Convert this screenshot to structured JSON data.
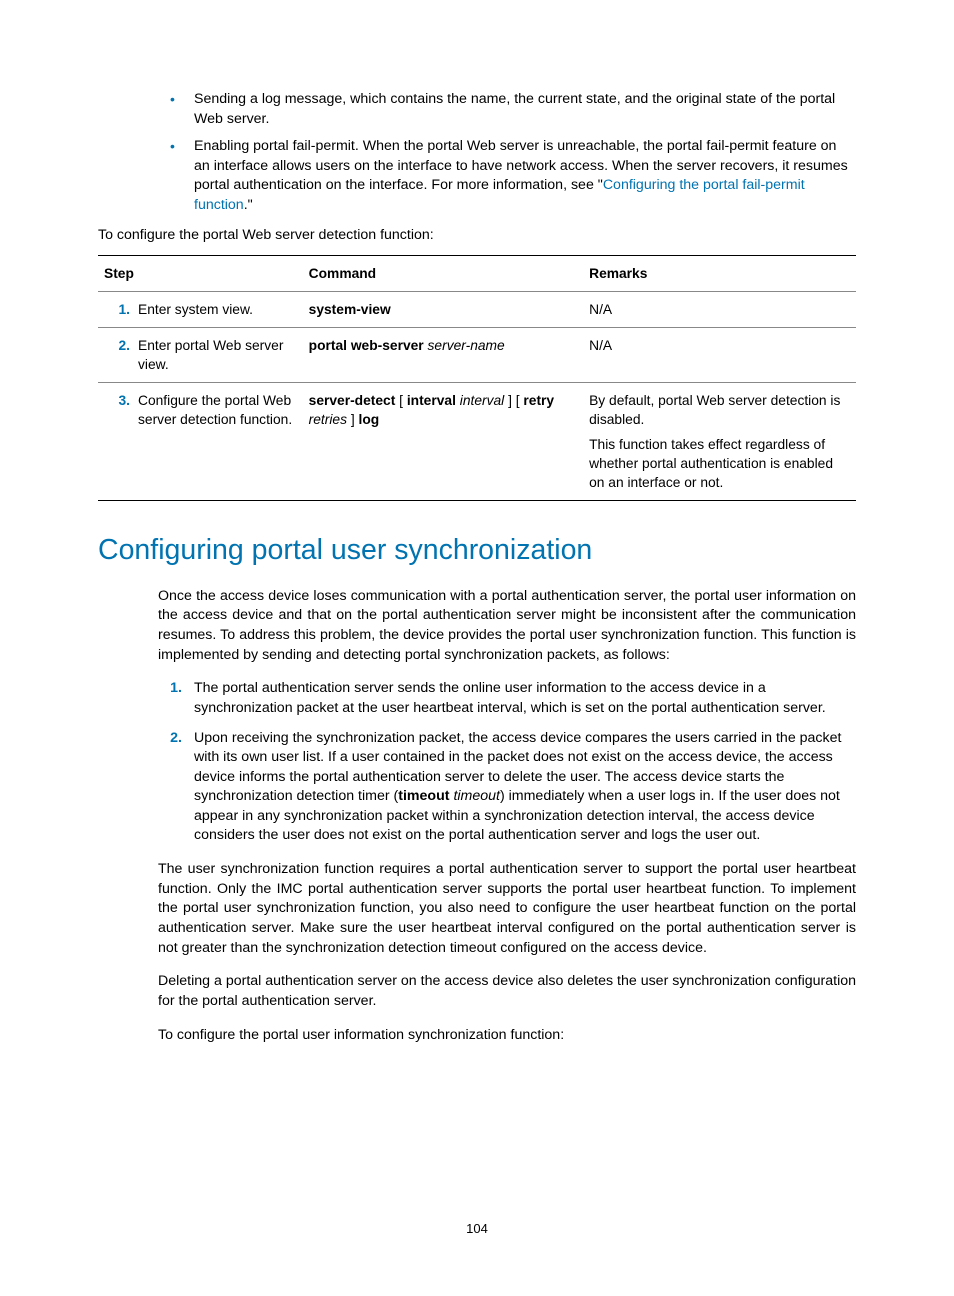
{
  "bullets": [
    {
      "text": "Sending a log message, which contains the name, the current state, and the original state of the portal Web server."
    },
    {
      "pre": "Enabling portal fail-permit. When the portal Web server is unreachable, the portal fail-permit feature on an interface allows users on the interface to have network access. When the server recovers, it resumes portal authentication on the interface. For more information, see \"",
      "link": "Configuring the portal fail-permit function",
      "post": ".\""
    }
  ],
  "lead1": "To configure the portal Web server detection function:",
  "table": {
    "headers": {
      "step": "Step",
      "command": "Command",
      "remarks": "Remarks"
    },
    "rows": [
      {
        "num": "1.",
        "desc": "Enter system view.",
        "cmd_html": "<span class=\"cmd-bold\">system-view</span>",
        "remarks_html": "N/A"
      },
      {
        "num": "2.",
        "desc": "Enter portal Web server view.",
        "cmd_html": "<span class=\"cmd-bold\">portal web-server</span> <span class=\"cmd-ital\">server-name</span>",
        "remarks_html": "N/A"
      },
      {
        "num": "3.",
        "desc": "Configure the portal Web server detection function.",
        "cmd_html": "<span class=\"cmd-bold\">server-detect</span> [ <span class=\"cmd-bold\">interval</span> <span class=\"cmd-ital\">interval</span> ] [ <span class=\"cmd-bold\">retry</span> <span class=\"cmd-ital\">retries</span> ] <span class=\"cmd-bold\">log</span>",
        "remarks_html": "<div class=\"remarks-multi\"><p>By default, portal Web server detection is disabled.</p><p>This function takes effect regardless of whether portal authentication is enabled on an interface or not.</p></div>"
      }
    ]
  },
  "heading": "Configuring portal user synchronization",
  "para1": "Once the access device loses communication with a portal authentication server, the portal user information on the access device and that on the portal authentication server might be inconsistent after the communication resumes. To address this problem, the device provides the portal user synchronization function. This function is implemented by sending and detecting portal synchronization packets, as follows:",
  "numlist": [
    {
      "n": "1.",
      "text": "The portal authentication server sends the online user information to the access device in a synchronization packet at the user heartbeat interval, which is set on the portal authentication server."
    },
    {
      "n": "2.",
      "pre": "Upon receiving the synchronization packet, the access device compares the users carried in the packet with its own user list. If a user contained in the packet does not exist on the access device, the access device informs the portal authentication server to delete the user. The access device starts the synchronization detection timer (",
      "bold": "timeout",
      "ital": "timeout",
      "post": ") immediately when a user logs in. If the user does not appear in any synchronization packet within a synchronization detection interval, the access device considers the user does not exist on the portal authentication server and logs the user out."
    }
  ],
  "para2": "The user synchronization function requires a portal authentication server to support the portal user heartbeat function. Only the IMC portal authentication server supports the portal user heartbeat function. To implement the portal user synchronization function, you also need to configure the user heartbeat function on the portal authentication server. Make sure the user heartbeat interval configured on the portal authentication server is not greater than the synchronization detection timeout configured on the access device.",
  "para3": "Deleting a portal authentication server on the access device also deletes the user synchronization configuration for the portal authentication server.",
  "para4": "To configure the portal user information synchronization function:",
  "pagenum": "104"
}
